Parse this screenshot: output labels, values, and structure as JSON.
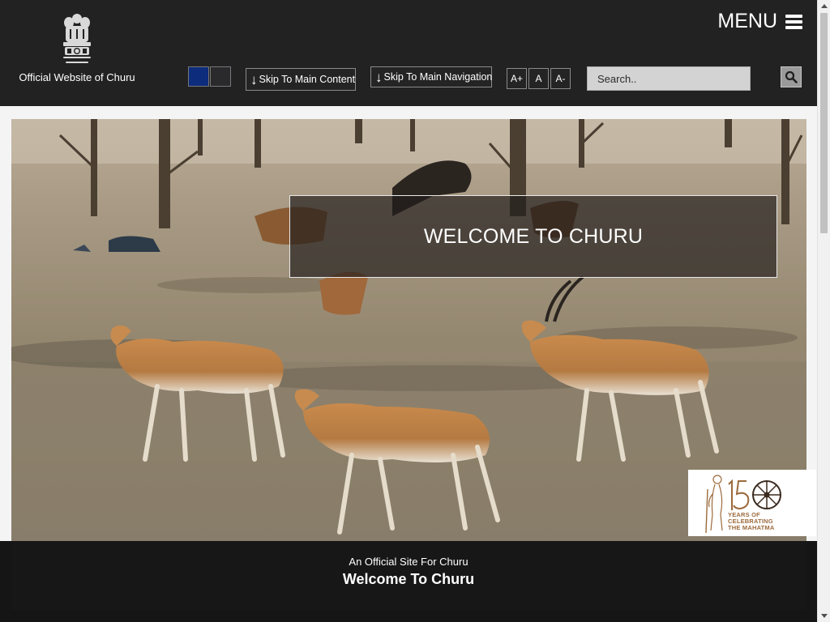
{
  "header": {
    "site_name": "Official Website of Churu",
    "menu_label": "MENU",
    "theme_swatches": [
      {
        "name": "blue",
        "color": "#0d2c7c"
      },
      {
        "name": "dark",
        "color": "#2a2a2c"
      }
    ],
    "skip_main_content": "Skip To Main Content",
    "skip_main_navigation": "Skip To Main Navigation",
    "skip_arrow": "↓",
    "font_increase": "A+",
    "font_normal": "A",
    "font_decrease": "A-",
    "search_placeholder": "Search..",
    "search_icon": "magnifier-icon"
  },
  "hero": {
    "welcome_title": "WELCOME TO CHURU",
    "band_subtitle": "An Official Site For Churu",
    "band_title": "Welcome To Churu",
    "badge": {
      "line1": "YEARS OF",
      "line2": "CELEBRATING",
      "line3": "THE MAHATMA",
      "number": "150"
    }
  },
  "colors": {
    "header_bg": "#222223",
    "accent_blue": "#0d2c7c",
    "badge_brown": "#9c6a3c"
  }
}
